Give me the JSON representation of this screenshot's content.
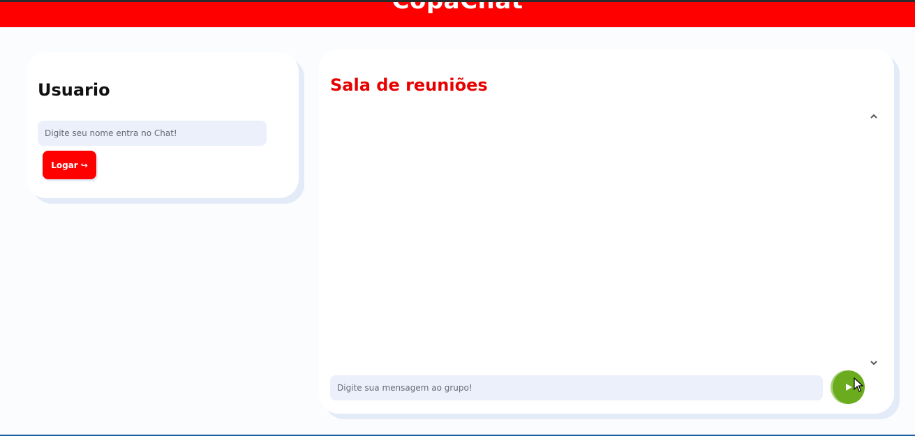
{
  "header": {
    "brand": "CopaChat",
    "color": "#ff0000"
  },
  "user_panel": {
    "title": "Usuario",
    "name_input": {
      "value": "",
      "placeholder": "Digite seu nome entra no Chat!"
    },
    "login_button": {
      "label": "Logar",
      "icon": "login-arrow-icon",
      "glyph": "↪"
    }
  },
  "chat_panel": {
    "title": "Sala de reuniões",
    "messages": [],
    "scroll_up_icon": "chevron-up-icon",
    "scroll_down_icon": "chevron-down-icon",
    "message_input": {
      "value": "",
      "placeholder": "Digite sua mensagem ao grupo!"
    },
    "send_button": {
      "icon": "play-send-icon",
      "color": "#6aac1d"
    }
  },
  "colors": {
    "accent_red": "#ff0000",
    "title_red": "#e60000",
    "input_bg": "#ebf0fb",
    "send_green": "#6aac1d"
  }
}
